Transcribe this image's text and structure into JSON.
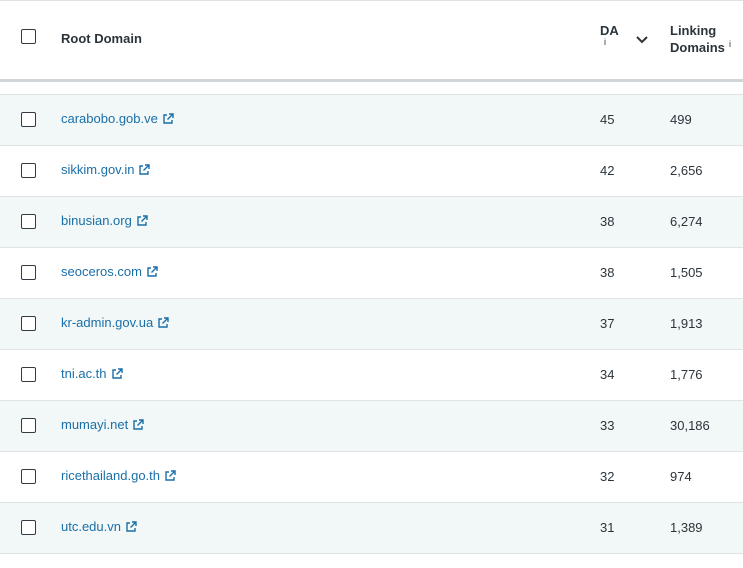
{
  "header": {
    "root_domain": "Root Domain",
    "da": "DA",
    "da_info": "i",
    "linking_line1": "Linking",
    "linking_line2": "Domains",
    "linking_info": "i",
    "sort_icon": "chevron-down"
  },
  "rows": [
    {
      "domain": "carabobo.gob.ve",
      "da": "45",
      "linking": "499"
    },
    {
      "domain": "sikkim.gov.in",
      "da": "42",
      "linking": "2,656"
    },
    {
      "domain": "binusian.org",
      "da": "38",
      "linking": "6,274"
    },
    {
      "domain": "seoceros.com",
      "da": "38",
      "linking": "1,505"
    },
    {
      "domain": "kr-admin.gov.ua",
      "da": "37",
      "linking": "1,913"
    },
    {
      "domain": "tni.ac.th",
      "da": "34",
      "linking": "1,776"
    },
    {
      "domain": "mumayi.net",
      "da": "33",
      "linking": "30,186"
    },
    {
      "domain": "ricethailand.go.th",
      "da": "32",
      "linking": "974"
    },
    {
      "domain": "utc.edu.vn",
      "da": "31",
      "linking": "1,389"
    }
  ],
  "colors": {
    "link": "#1a6fa8",
    "alt_row": "#f1f8f7",
    "border": "#dfe3e6"
  }
}
